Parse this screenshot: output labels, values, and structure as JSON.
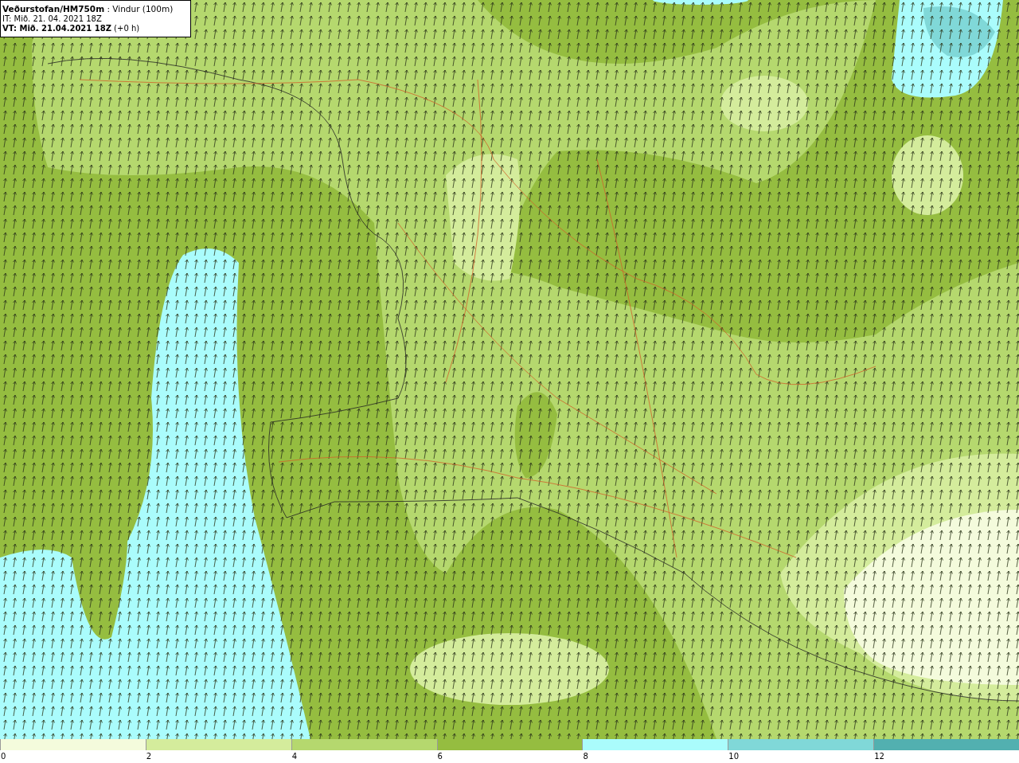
{
  "header": {
    "lines": [
      "**Veðurstofan/HM750m** : Vindur (100m)",
      "IT: Mið. 21. 04. 2021 18Z",
      "**VT: Mið. 21.04.2021 18Z** (+0 h)"
    ]
  },
  "legend": {
    "bins": [
      {
        "label": "0",
        "color": "#f4fbdc"
      },
      {
        "label": "2",
        "color": "#d4ec9c"
      },
      {
        "label": "4",
        "color": "#b5d86e"
      },
      {
        "label": "6",
        "color": "#95bd40"
      },
      {
        "label": "8",
        "color": "#aafcfc"
      },
      {
        "label": "10",
        "color": "#80d8d8"
      },
      {
        "label": "12",
        "color": "#52b0b0"
      }
    ]
  }
}
